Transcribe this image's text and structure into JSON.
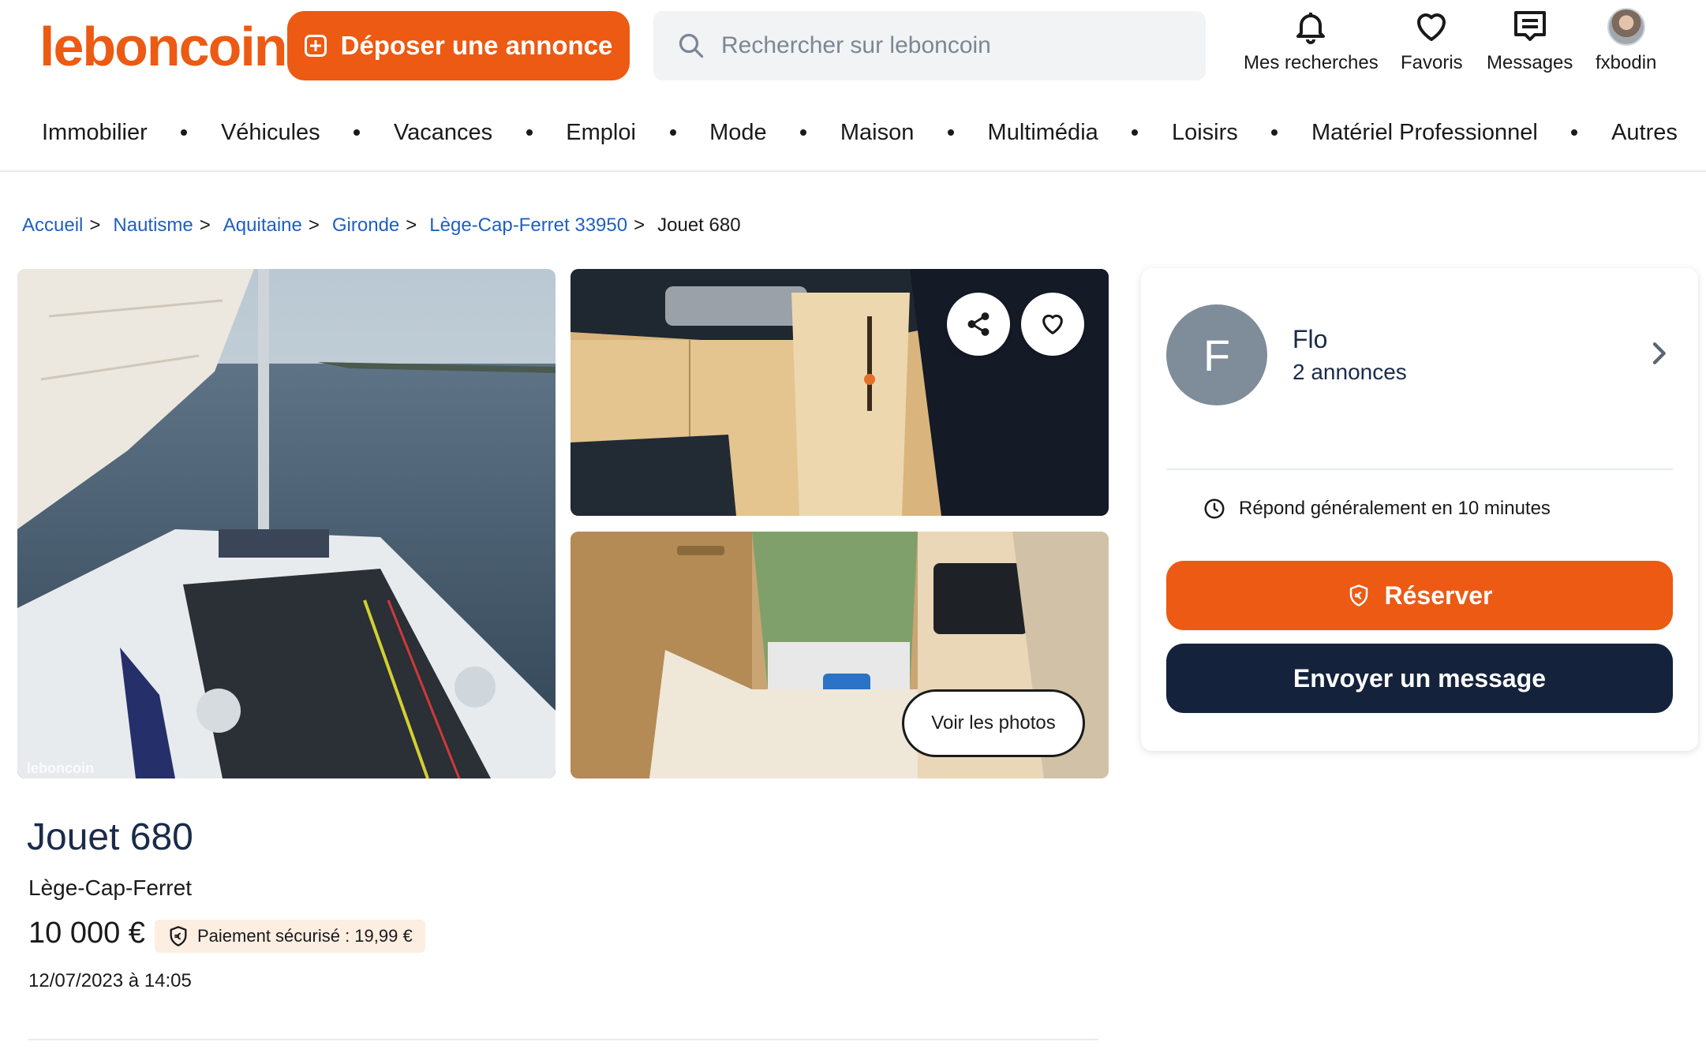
{
  "header": {
    "logo": "leboncoin",
    "deposit_label": "Déposer une annonce",
    "search_placeholder": "Rechercher sur leboncoin",
    "links": {
      "searches": "Mes recherches",
      "favorites": "Favoris",
      "messages": "Messages",
      "account": "fxbodin"
    }
  },
  "categories": [
    "Immobilier",
    "Véhicules",
    "Vacances",
    "Emploi",
    "Mode",
    "Maison",
    "Multimédia",
    "Loisirs",
    "Matériel Professionnel",
    "Autres"
  ],
  "breadcrumb": {
    "items": [
      "Accueil",
      "Nautisme",
      "Aquitaine",
      "Gironde",
      "Lège-Cap-Ferret 33950"
    ],
    "separator": ">",
    "current": "Jouet 680"
  },
  "gallery": {
    "watermark": "leboncoin",
    "view_photos_label": "Voir les photos",
    "share_icon": "share-icon",
    "favorite_icon": "heart-icon"
  },
  "listing": {
    "title": "Jouet 680",
    "location": "Lège-Cap-Ferret",
    "price": "10 000 €",
    "secure_payment": "Paiement sécurisé : 19,99 €",
    "date": "12/07/2023 à 14:05"
  },
  "seller": {
    "initial": "F",
    "name": "Flo",
    "ads_count": "2 annonces",
    "response_time": "Répond généralement en 10 minutes",
    "reserve_label": "Réserver",
    "message_label": "Envoyer un message"
  },
  "colors": {
    "brand_orange": "#ec5a13",
    "navy": "#14233b",
    "link_blue": "#1f5fbf",
    "badge_bg": "#fdeee2",
    "avatar_grey": "#7f8c99"
  }
}
